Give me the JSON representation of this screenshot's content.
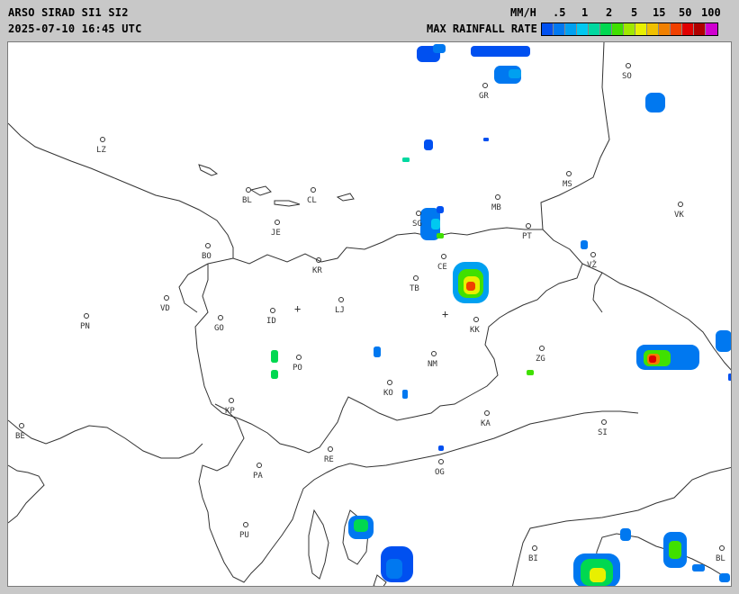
{
  "header": {
    "line1": "ARSO SIRAD SI1 SI2",
    "line2": "2025-07-10 16:45 UTC",
    "units": "MM/H",
    "rate_label": "MAX RAINFALL RATE"
  },
  "legend": {
    "ticks": [
      ".5",
      "1",
      "2",
      "5",
      "15",
      "50",
      "100"
    ],
    "colors": [
      "#0050f0",
      "#0078f0",
      "#00a0f0",
      "#00c8f0",
      "#00d8a0",
      "#00d850",
      "#40e000",
      "#a0e800",
      "#e8f000",
      "#f0c000",
      "#f08000",
      "#f04000",
      "#e00000",
      "#b00000",
      "#d000d0"
    ]
  },
  "cities": [
    {
      "code": "LZ"
    },
    {
      "code": "BL"
    },
    {
      "code": "CL"
    },
    {
      "code": "GR"
    },
    {
      "code": "SO"
    },
    {
      "code": "MB"
    },
    {
      "code": "MS"
    },
    {
      "code": "VK"
    },
    {
      "code": "SG"
    },
    {
      "code": "JE"
    },
    {
      "code": "BO"
    },
    {
      "code": "KR"
    },
    {
      "code": "CE"
    },
    {
      "code": "PT"
    },
    {
      "code": "VŽ"
    },
    {
      "code": "TB"
    },
    {
      "code": "VD"
    },
    {
      "code": "LJ"
    },
    {
      "code": "PN"
    },
    {
      "code": "ID"
    },
    {
      "code": "GO"
    },
    {
      "code": "KK"
    },
    {
      "code": "NM"
    },
    {
      "code": "ZG"
    },
    {
      "code": "PO"
    },
    {
      "code": "KO"
    },
    {
      "code": "KP"
    },
    {
      "code": "KA"
    },
    {
      "code": "SI"
    },
    {
      "code": "BE"
    },
    {
      "code": "RE"
    },
    {
      "code": "PA"
    },
    {
      "code": "OG"
    },
    {
      "code": "PU"
    },
    {
      "code": "BI"
    },
    {
      "code": "BL"
    }
  ]
}
